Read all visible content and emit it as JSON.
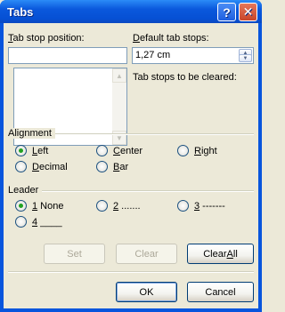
{
  "window": {
    "title": "Tabs",
    "help_glyph": "?",
    "close_glyph": "✕"
  },
  "tab_stop": {
    "label_u": "T",
    "label_rest": "ab stop position:",
    "value": ""
  },
  "default_tab": {
    "label_u": "D",
    "label_rest": "efault tab stops:",
    "value": "1,27 cm"
  },
  "cleared_label": "Tab stops to be cleared:",
  "alignment": {
    "title": "Alignment",
    "options": [
      {
        "u": "L",
        "rest": "eft",
        "checked": true
      },
      {
        "u": "C",
        "rest": "enter",
        "checked": false
      },
      {
        "u": "R",
        "rest": "ight",
        "checked": false
      },
      {
        "u": "D",
        "rest": "ecimal",
        "checked": false
      },
      {
        "u": "B",
        "rest": "ar",
        "checked": false
      }
    ]
  },
  "leader": {
    "title": "Leader",
    "options": [
      {
        "u": "1",
        "rest": " None",
        "checked": true
      },
      {
        "u": "2",
        "rest": " .......",
        "checked": false
      },
      {
        "u": "3",
        "rest": " -------",
        "checked": false
      },
      {
        "u": "4",
        "rest": " ____",
        "checked": false
      }
    ]
  },
  "buttons": {
    "set": "Set",
    "clear": "Clear",
    "clear_all_pre": "Clear ",
    "clear_all_u": "A",
    "clear_all_post": "ll",
    "ok": "OK",
    "cancel": "Cancel"
  }
}
